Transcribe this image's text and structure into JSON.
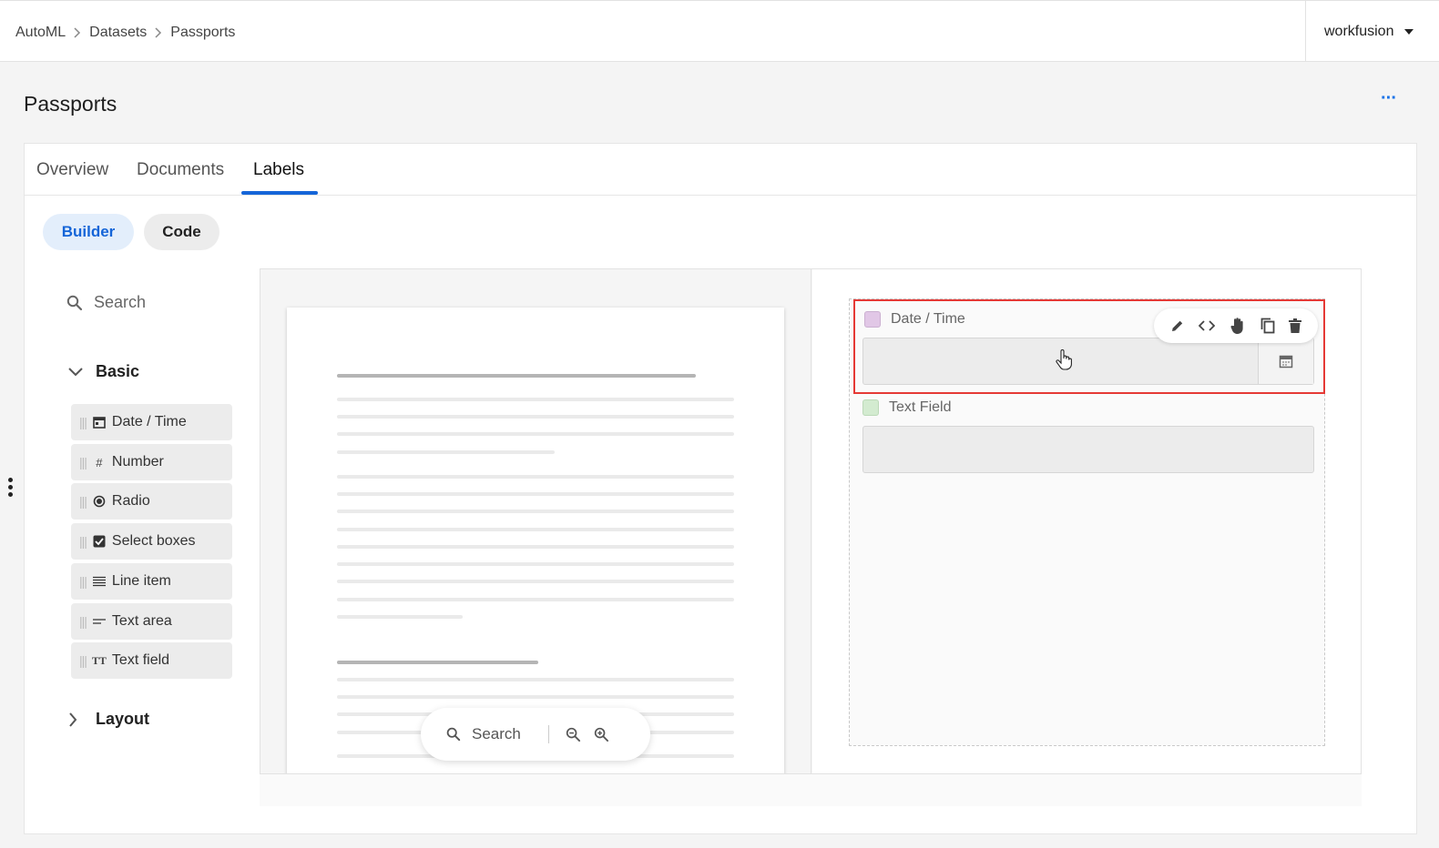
{
  "breadcrumb": {
    "items": [
      "AutoML",
      "Datasets",
      "Passports"
    ]
  },
  "account": {
    "name": "workfusion"
  },
  "page": {
    "title": "Passports",
    "more_label": "···"
  },
  "tabs": [
    {
      "label": "Overview",
      "active": false
    },
    {
      "label": "Documents",
      "active": false
    },
    {
      "label": "Labels",
      "active": true
    }
  ],
  "mode": {
    "builder_label": "Builder",
    "code_label": "Code",
    "selected": "Builder"
  },
  "palette": {
    "search_placeholder": "Search",
    "groups": [
      {
        "label": "Basic",
        "expanded": true
      },
      {
        "label": "Layout",
        "expanded": false
      }
    ],
    "components": [
      {
        "label": "Date / Time",
        "icon": "calendar-icon"
      },
      {
        "label": "Number",
        "icon": "hash-icon"
      },
      {
        "label": "Radio",
        "icon": "radio-icon"
      },
      {
        "label": "Select boxes",
        "icon": "checkbox-icon"
      },
      {
        "label": "Line item",
        "icon": "list-icon"
      },
      {
        "label": "Text area",
        "icon": "text-area-icon"
      },
      {
        "label": "Text field",
        "icon": "text-field-icon"
      }
    ]
  },
  "document_viewer": {
    "search_label": "Search"
  },
  "form": {
    "fields": [
      {
        "label": "Date / Time",
        "swatch_color": "#e1c7e6",
        "selected": true
      },
      {
        "label": "Text Field",
        "swatch_color": "#d3ebd0",
        "selected": false
      }
    ]
  },
  "colors": {
    "accent": "#1565d8",
    "selection": "#e53935"
  }
}
